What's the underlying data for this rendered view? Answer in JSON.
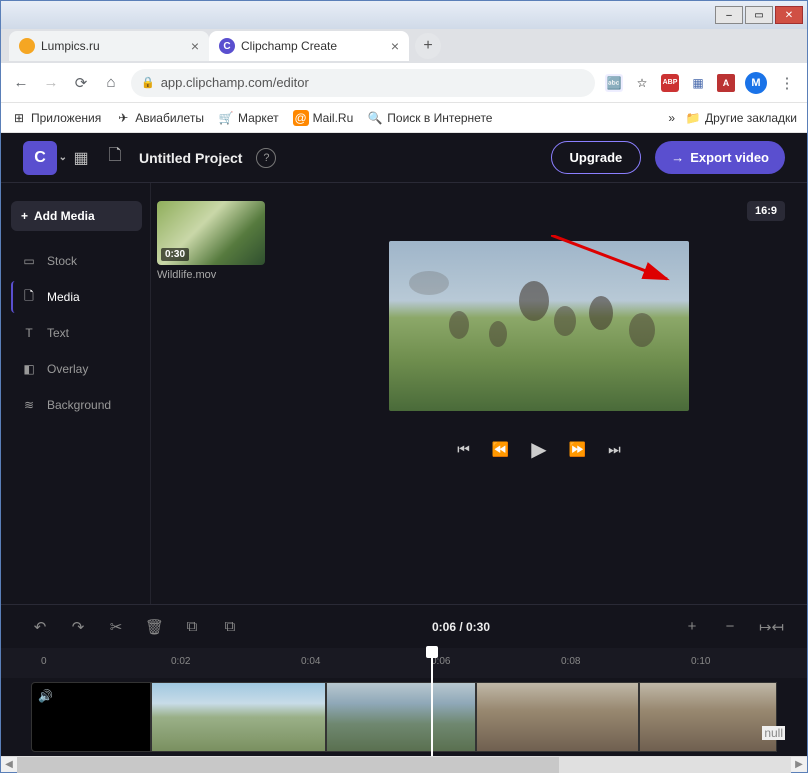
{
  "window": {
    "minimize": "–",
    "maximize": "▭",
    "close": "✕"
  },
  "tabs": [
    {
      "title": "Lumpics.ru",
      "active": false
    },
    {
      "title": "Clipchamp Create",
      "active": true,
      "favicon_letter": "C"
    }
  ],
  "newtab": "+",
  "nav": {
    "back": "←",
    "forward": "→",
    "reload": "⟳",
    "home": "⌂"
  },
  "url": {
    "lock": "🔒",
    "text": "app.clipchamp.com/editor"
  },
  "ext": {
    "translate": "⇄",
    "star": "☆",
    "abp": "ABP",
    "ev": "□",
    "pdf": "A",
    "avatar": "M",
    "menu": "⋮"
  },
  "bookmarks": {
    "apps": "Приложения",
    "avia": "Авиабилеты",
    "market": "Маркет",
    "mail": "Mail.Ru",
    "search": "Поиск в Интернете",
    "more": "»",
    "other": "Другие закладки"
  },
  "appbar": {
    "logo": "C",
    "chev": "⌄",
    "film_icon": "▦",
    "doc_icon": "🗋",
    "title": "Untitled Project",
    "help": "?",
    "upgrade": "Upgrade",
    "export": "Export video",
    "export_arrow": "→"
  },
  "sidebar": {
    "add": "Add Media",
    "items": [
      {
        "icon": "▭",
        "label": "Stock"
      },
      {
        "icon": "🗋",
        "label": "Media"
      },
      {
        "icon": "T",
        "label": "Text"
      },
      {
        "icon": "◧",
        "label": "Overlay"
      },
      {
        "icon": "≋",
        "label": "Background"
      }
    ]
  },
  "media": {
    "duration": "0:30",
    "name": "Wildlife.mov"
  },
  "preview": {
    "aspect": "16:9",
    "controls": {
      "first": "⏮",
      "rew": "⏪",
      "play": "▶",
      "ff": "⏩",
      "last": "⏭"
    }
  },
  "timeline": {
    "tools": {
      "undo": "↶",
      "redo": "↷",
      "cut": "✂",
      "del": "🗑",
      "copy": "⧉",
      "copy2": "⧉"
    },
    "timecode": "0:06 / 0:30",
    "zoom": {
      "in": "+",
      "out": "−",
      "fit": "↦↤"
    },
    "ticks": [
      "0",
      "0:02",
      "0:04",
      "0:06",
      "0:08",
      "0:10"
    ],
    "audio_icon": "🔊"
  },
  "null_text": "null"
}
